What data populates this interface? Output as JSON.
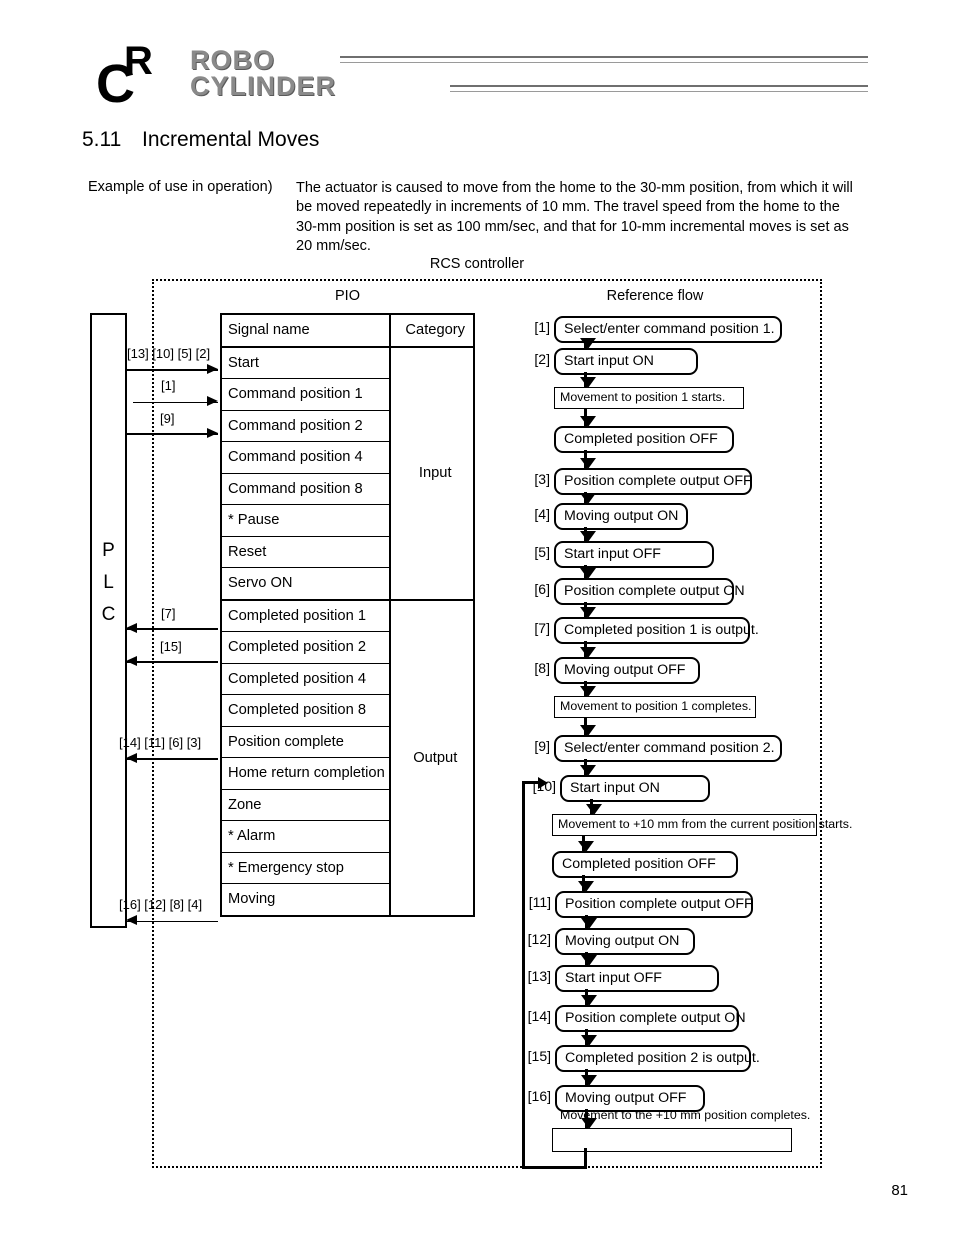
{
  "header": {
    "logo_mark": "rc-logo-mark",
    "logo_line1": "ROBO",
    "logo_line2": "CYLINDER"
  },
  "section": {
    "number": "5.11",
    "title": "Incremental Moves"
  },
  "intro": {
    "label": "Example of use in operation)",
    "body": "The actuator is caused to move from the home to the 30-mm position, from which it will be moved repeatedly in increments of 10 mm. The travel speed from the home to the 30-mm position is set as 100 mm/sec, and that for 10-mm incremental moves is set as 20 mm/sec."
  },
  "diagram": {
    "controller_caption": "RCS controller",
    "pio_caption": "PIO",
    "flow_caption": "Reference flow",
    "plc_label": "PLC",
    "table": {
      "headers": [
        "Signal name",
        "Category"
      ],
      "input_category": "Input",
      "output_category": "Output",
      "input_signals": [
        "Start",
        "Command position 1",
        "Command position 2",
        "Command position 4",
        "Command position 8",
        "* Pause",
        "Reset",
        "Servo ON"
      ],
      "output_signals": [
        "Completed position 1",
        "Completed position 2",
        "Completed position 4",
        "Completed position 8",
        "Position complete",
        "Home return completion",
        "Zone",
        "* Alarm",
        "* Emergency stop",
        "Moving"
      ]
    },
    "signal_arrows": [
      {
        "label": "[13] [10] [5] [2]",
        "direction": "to-controller",
        "signal": "Start"
      },
      {
        "label": "[1]",
        "direction": "to-controller",
        "signal": "Command position 1"
      },
      {
        "label": "[9]",
        "direction": "to-controller",
        "signal": "Command position 2"
      },
      {
        "label": "[7]",
        "direction": "to-plc",
        "signal": "Completed position 1"
      },
      {
        "label": "[15]",
        "direction": "to-plc",
        "signal": "Completed position 2"
      },
      {
        "label": "[14] [11] [6] [3]",
        "direction": "to-plc",
        "signal": "Position complete"
      },
      {
        "label": "[16] [12] [8] [4]",
        "direction": "to-plc",
        "signal": "Moving"
      }
    ],
    "flow_steps": [
      {
        "index": "[1]",
        "text": "Select/enter command position 1.",
        "shape": "rounded"
      },
      {
        "index": "[2]",
        "text": "Start input ON",
        "shape": "rounded"
      },
      {
        "index": "",
        "text": "Movement to position 1 starts.",
        "shape": "rect"
      },
      {
        "index": "",
        "text": "Completed position OFF",
        "shape": "rounded"
      },
      {
        "index": "[3]",
        "text": "Position complete output OFF",
        "shape": "rounded"
      },
      {
        "index": "[4]",
        "text": "Moving output ON",
        "shape": "rounded"
      },
      {
        "index": "[5]",
        "text": "Start input OFF",
        "shape": "rounded"
      },
      {
        "index": "[6]",
        "text": "Position complete output ON",
        "shape": "rounded"
      },
      {
        "index": "[7]",
        "text": "Completed position 1 is output.",
        "shape": "rounded"
      },
      {
        "index": "[8]",
        "text": "Moving output OFF",
        "shape": "rounded"
      },
      {
        "index": "",
        "text": "Movement to position 1 completes.",
        "shape": "rect"
      },
      {
        "index": "[9]",
        "text": "Select/enter command position 2.",
        "shape": "rounded"
      },
      {
        "index": "[10]",
        "text": "Start input ON",
        "shape": "rounded"
      },
      {
        "index": "",
        "text": "Movement to +10 mm from the current position starts.",
        "shape": "rect"
      },
      {
        "index": "",
        "text": "Completed position OFF",
        "shape": "rounded"
      },
      {
        "index": "[11]",
        "text": "Position complete output OFF",
        "shape": "rounded"
      },
      {
        "index": "[12]",
        "text": "Moving output ON",
        "shape": "rounded"
      },
      {
        "index": "[13]",
        "text": "Start input OFF",
        "shape": "rounded"
      },
      {
        "index": "[14]",
        "text": "Position complete output ON",
        "shape": "rounded"
      },
      {
        "index": "[15]",
        "text": "Completed position 2 is output.",
        "shape": "rounded"
      },
      {
        "index": "[16]",
        "text": "Moving output OFF",
        "shape": "rounded"
      },
      {
        "index": "",
        "text": "Movement to the +10 mm position completes.",
        "shape": "rect"
      }
    ]
  },
  "footer": {
    "page_number": "81"
  }
}
